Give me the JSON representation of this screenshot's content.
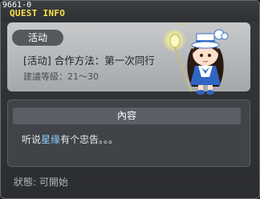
{
  "header": {
    "quest_id": "9661-0",
    "title": "QUEST INFO"
  },
  "quest": {
    "tag": "活动",
    "name": "[活动] 合作方法：第一次同行",
    "level": "建議等級：21～30"
  },
  "npc": {
    "icon": "npc-maid-with-lantern-icon"
  },
  "content": {
    "header": "內容",
    "text_before": "听说",
    "text_highlight": "星缘",
    "text_after": "有个忠告。。。",
    "highlight_color": "#8fd0ff"
  },
  "status": {
    "label": "狀態: 可開始"
  }
}
